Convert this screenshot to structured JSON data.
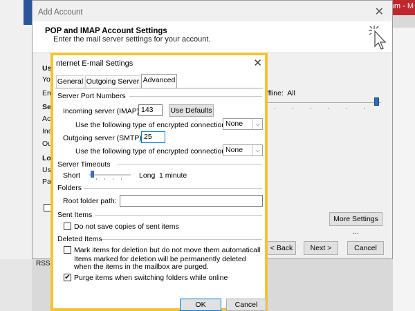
{
  "browser": {
    "url_fragment": ".com - M"
  },
  "add_account": {
    "title": "Add Account",
    "heading": "POP and IMAP Account Settings",
    "subheading": "Enter the mail server settings for your account.",
    "side_labels": [
      "Use",
      "You",
      "Em",
      "Ser",
      "Acc",
      "Inc",
      "Out",
      "Log",
      "Use",
      "Pas"
    ],
    "offline_label": "ffline:",
    "offline_value": "All",
    "more_settings": "More Settings ...",
    "back": "< Back",
    "next": "Next >",
    "cancel": "Cancel",
    "slider_level": 1.0
  },
  "rss_label": "RSS F",
  "dialog": {
    "title": "nternet E-mail Settings",
    "tabs": [
      "General",
      "Outgoing Server",
      "Advanced"
    ],
    "active_tab": "Advanced",
    "server_port_numbers": {
      "heading": "Server Port Numbers",
      "incoming_label": "Incoming server (IMAP):",
      "incoming_value": "143",
      "use_defaults": "Use Defaults",
      "encryption_label": "Use the following type of encrypted connection:",
      "encryption_value_in": "None",
      "outgoing_label": "Outgoing server (SMTP):",
      "outgoing_value": "25",
      "encryption_value_out": "None"
    },
    "server_timeouts": {
      "heading": "Server Timeouts",
      "short": "Short",
      "long": "Long",
      "value": "1 minute",
      "level": 0.1
    },
    "folders": {
      "heading": "Folders",
      "root_label": "Root folder path:",
      "root_value": ""
    },
    "sent_items": {
      "heading": "Sent Items",
      "do_not_save": "Do not save copies of sent items",
      "do_not_save_checked": false
    },
    "deleted_items": {
      "heading": "Deleted Items",
      "mark_label": "Mark items for deletion but do not move them automatically",
      "mark_checked": false,
      "note": "Items marked for deletion will be permanently deleted when the items in the mailbox are purged.",
      "purge_label": "Purge items when switching folders while online",
      "purge_checked": true
    },
    "ok": "OK",
    "cancel": "Cancel"
  },
  "colors": {
    "highlight_border": "#f4c430",
    "accent": "#0078d7",
    "outlook_red": "#c0272d"
  }
}
